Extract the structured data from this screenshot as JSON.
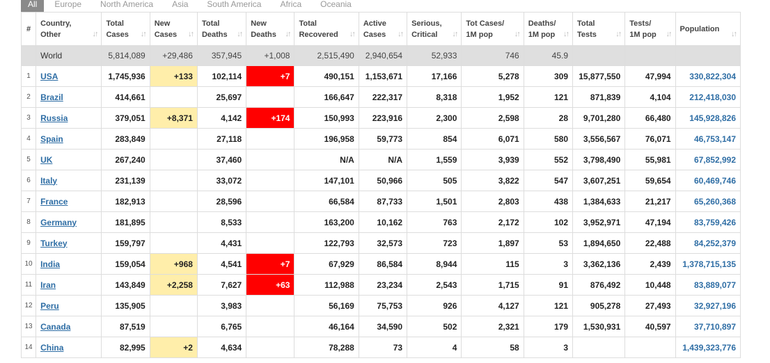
{
  "tabs": [
    {
      "label": "All",
      "active": true
    },
    {
      "label": "Europe",
      "active": false
    },
    {
      "label": "North America",
      "active": false
    },
    {
      "label": "Asia",
      "active": false
    },
    {
      "label": "South America",
      "active": false
    },
    {
      "label": "Africa",
      "active": false
    },
    {
      "label": "Oceania",
      "active": false
    }
  ],
  "headers": {
    "num": "#",
    "country_1": "Country,",
    "country_2": "Other",
    "total_cases_1": "Total",
    "total_cases_2": "Cases",
    "new_cases_1": "New",
    "new_cases_2": "Cases",
    "total_deaths_1": "Total",
    "total_deaths_2": "Deaths",
    "new_deaths_1": "New",
    "new_deaths_2": "Deaths",
    "total_recovered_1": "Total",
    "total_recovered_2": "Recovered",
    "active_cases_1": "Active",
    "active_cases_2": "Cases",
    "serious_1": "Serious,",
    "serious_2": "Critical",
    "cases_pop_1": "Tot Cases/",
    "cases_pop_2": "1M pop",
    "deaths_pop_1": "Deaths/",
    "deaths_pop_2": "1M pop",
    "total_tests_1": "Total",
    "total_tests_2": "Tests",
    "tests_pop_1": "Tests/",
    "tests_pop_2": "1M pop",
    "population": "Population"
  },
  "world": {
    "num": "",
    "country": "World",
    "total_cases": "5,814,089",
    "new_cases": "+29,486",
    "total_deaths": "357,945",
    "new_deaths": "+1,008",
    "total_recovered": "2,515,490",
    "active_cases": "2,940,654",
    "serious": "52,933",
    "cases_pop": "746",
    "deaths_pop": "45.9",
    "total_tests": "",
    "tests_pop": "",
    "population": ""
  },
  "rows": [
    {
      "num": "1",
      "country": "USA",
      "total_cases": "1,745,936",
      "new_cases": "+133",
      "total_deaths": "102,114",
      "new_deaths": "+7",
      "total_recovered": "490,151",
      "active_cases": "1,153,671",
      "serious": "17,166",
      "cases_pop": "5,278",
      "deaths_pop": "309",
      "total_tests": "15,877,550",
      "tests_pop": "47,994",
      "population": "330,822,304"
    },
    {
      "num": "2",
      "country": "Brazil",
      "total_cases": "414,661",
      "new_cases": "",
      "total_deaths": "25,697",
      "new_deaths": "",
      "total_recovered": "166,647",
      "active_cases": "222,317",
      "serious": "8,318",
      "cases_pop": "1,952",
      "deaths_pop": "121",
      "total_tests": "871,839",
      "tests_pop": "4,104",
      "population": "212,418,030"
    },
    {
      "num": "3",
      "country": "Russia",
      "total_cases": "379,051",
      "new_cases": "+8,371",
      "total_deaths": "4,142",
      "new_deaths": "+174",
      "total_recovered": "150,993",
      "active_cases": "223,916",
      "serious": "2,300",
      "cases_pop": "2,598",
      "deaths_pop": "28",
      "total_tests": "9,701,280",
      "tests_pop": "66,480",
      "population": "145,928,826"
    },
    {
      "num": "4",
      "country": "Spain",
      "total_cases": "283,849",
      "new_cases": "",
      "total_deaths": "27,118",
      "new_deaths": "",
      "total_recovered": "196,958",
      "active_cases": "59,773",
      "serious": "854",
      "cases_pop": "6,071",
      "deaths_pop": "580",
      "total_tests": "3,556,567",
      "tests_pop": "76,071",
      "population": "46,753,147"
    },
    {
      "num": "5",
      "country": "UK",
      "total_cases": "267,240",
      "new_cases": "",
      "total_deaths": "37,460",
      "new_deaths": "",
      "total_recovered": "N/A",
      "active_cases": "N/A",
      "serious": "1,559",
      "cases_pop": "3,939",
      "deaths_pop": "552",
      "total_tests": "3,798,490",
      "tests_pop": "55,981",
      "population": "67,852,992"
    },
    {
      "num": "6",
      "country": "Italy",
      "total_cases": "231,139",
      "new_cases": "",
      "total_deaths": "33,072",
      "new_deaths": "",
      "total_recovered": "147,101",
      "active_cases": "50,966",
      "serious": "505",
      "cases_pop": "3,822",
      "deaths_pop": "547",
      "total_tests": "3,607,251",
      "tests_pop": "59,654",
      "population": "60,469,746"
    },
    {
      "num": "7",
      "country": "France",
      "total_cases": "182,913",
      "new_cases": "",
      "total_deaths": "28,596",
      "new_deaths": "",
      "total_recovered": "66,584",
      "active_cases": "87,733",
      "serious": "1,501",
      "cases_pop": "2,803",
      "deaths_pop": "438",
      "total_tests": "1,384,633",
      "tests_pop": "21,217",
      "population": "65,260,368"
    },
    {
      "num": "8",
      "country": "Germany",
      "total_cases": "181,895",
      "new_cases": "",
      "total_deaths": "8,533",
      "new_deaths": "",
      "total_recovered": "163,200",
      "active_cases": "10,162",
      "serious": "763",
      "cases_pop": "2,172",
      "deaths_pop": "102",
      "total_tests": "3,952,971",
      "tests_pop": "47,194",
      "population": "83,759,426"
    },
    {
      "num": "9",
      "country": "Turkey",
      "total_cases": "159,797",
      "new_cases": "",
      "total_deaths": "4,431",
      "new_deaths": "",
      "total_recovered": "122,793",
      "active_cases": "32,573",
      "serious": "723",
      "cases_pop": "1,897",
      "deaths_pop": "53",
      "total_tests": "1,894,650",
      "tests_pop": "22,488",
      "population": "84,252,379"
    },
    {
      "num": "10",
      "country": "India",
      "total_cases": "159,054",
      "new_cases": "+968",
      "total_deaths": "4,541",
      "new_deaths": "+7",
      "total_recovered": "67,929",
      "active_cases": "86,584",
      "serious": "8,944",
      "cases_pop": "115",
      "deaths_pop": "3",
      "total_tests": "3,362,136",
      "tests_pop": "2,439",
      "population": "1,378,715,135"
    },
    {
      "num": "11",
      "country": "Iran",
      "total_cases": "143,849",
      "new_cases": "+2,258",
      "total_deaths": "7,627",
      "new_deaths": "+63",
      "total_recovered": "112,988",
      "active_cases": "23,234",
      "serious": "2,543",
      "cases_pop": "1,715",
      "deaths_pop": "91",
      "total_tests": "876,492",
      "tests_pop": "10,448",
      "population": "83,889,077"
    },
    {
      "num": "12",
      "country": "Peru",
      "total_cases": "135,905",
      "new_cases": "",
      "total_deaths": "3,983",
      "new_deaths": "",
      "total_recovered": "56,169",
      "active_cases": "75,753",
      "serious": "926",
      "cases_pop": "4,127",
      "deaths_pop": "121",
      "total_tests": "905,278",
      "tests_pop": "27,493",
      "population": "32,927,196"
    },
    {
      "num": "13",
      "country": "Canada",
      "total_cases": "87,519",
      "new_cases": "",
      "total_deaths": "6,765",
      "new_deaths": "",
      "total_recovered": "46,164",
      "active_cases": "34,590",
      "serious": "502",
      "cases_pop": "2,321",
      "deaths_pop": "179",
      "total_tests": "1,530,931",
      "tests_pop": "40,597",
      "population": "37,710,897"
    },
    {
      "num": "14",
      "country": "China",
      "total_cases": "82,995",
      "new_cases": "+2",
      "total_deaths": "4,634",
      "new_deaths": "",
      "total_recovered": "78,288",
      "active_cases": "73",
      "serious": "4",
      "cases_pop": "58",
      "deaths_pop": "3",
      "total_tests": "",
      "tests_pop": "",
      "population": "1,439,323,776"
    }
  ],
  "colors": {
    "new_cases_highlight": "#ffeeaa",
    "new_deaths_highlight": "#ff0000",
    "link": "#2f6ea5",
    "world_row": "#dfdfdf",
    "active_tab": "#8a8a8a"
  },
  "icons": {
    "sort": "sort-arrows-icon"
  }
}
